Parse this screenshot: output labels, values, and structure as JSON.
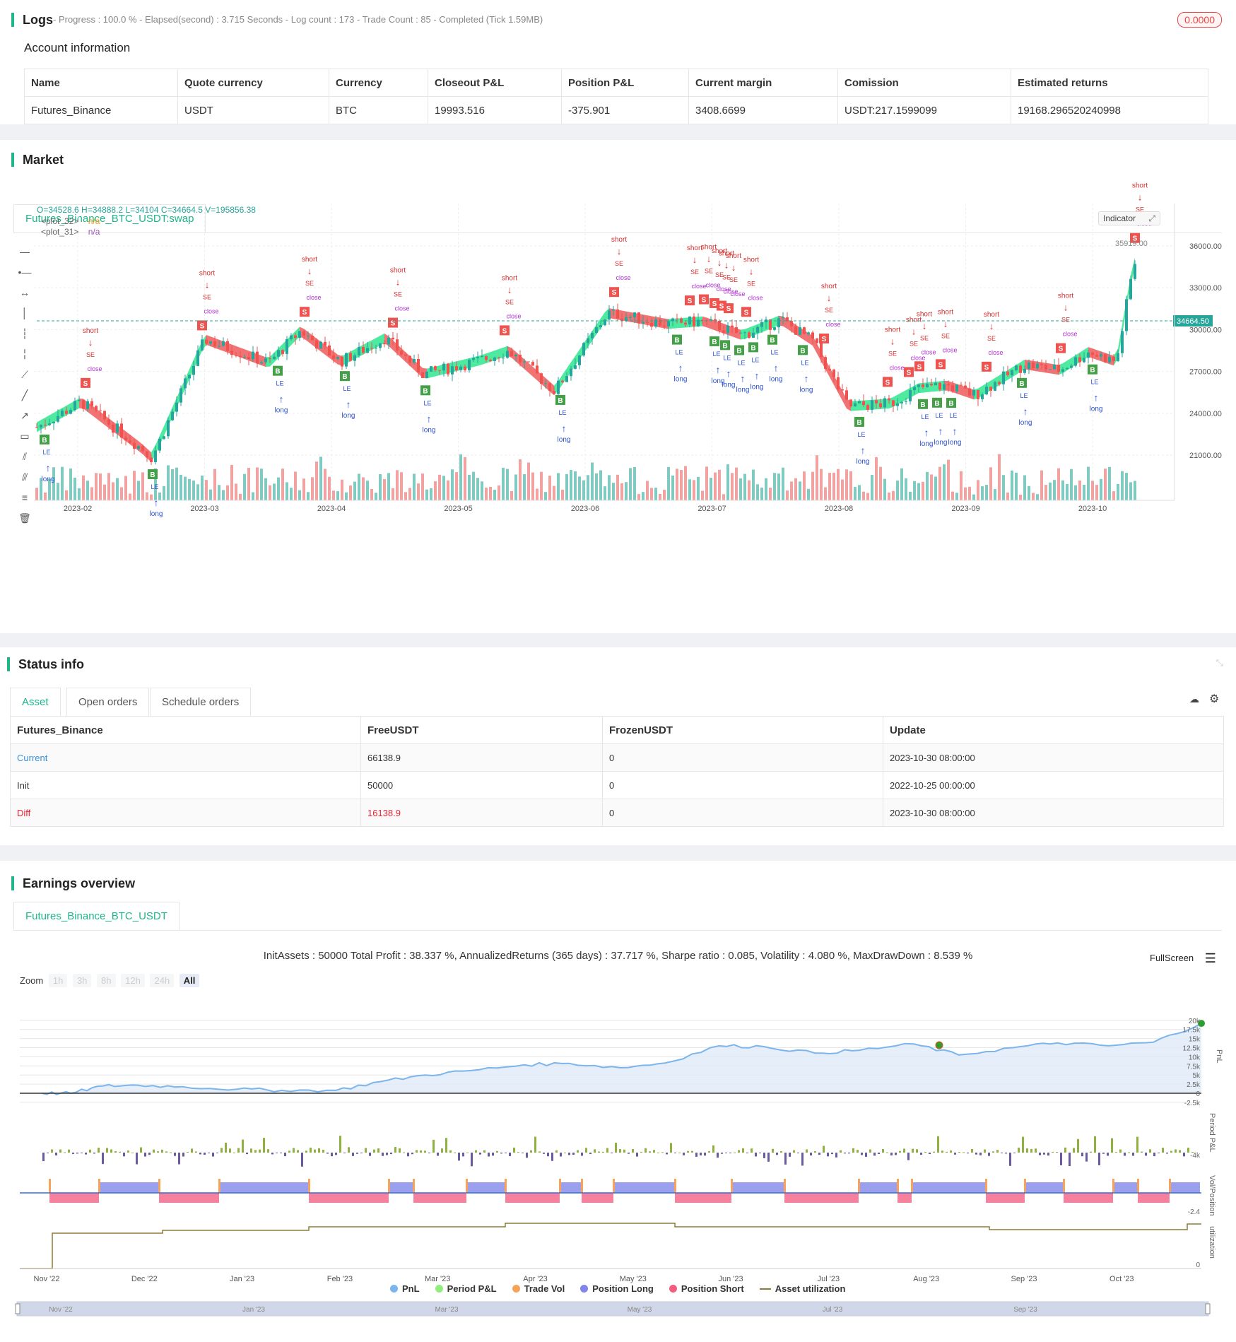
{
  "logs": {
    "title": "Logs",
    "meta": "- Progress : 100.0 % - Elapsed(second) : 3.715  Seconds - Log count : 173 - Trade Count : 85 - Completed (Tick 1.59MB)",
    "badge": "0.0000"
  },
  "account": {
    "title": "Account information",
    "headers": [
      "Name",
      "Quote currency",
      "Currency",
      "Closeout P&L",
      "Position P&L",
      "Current margin",
      "Comission",
      "Estimated returns"
    ],
    "row": [
      "Futures_Binance",
      "USDT",
      "BTC",
      "19993.516",
      "-375.901",
      "3408.6699",
      "USDT:217.1599099",
      "19168.296520240998"
    ]
  },
  "market": {
    "title": "Market",
    "tab": "Futures_Binance_BTC_USDT:swap",
    "ohlc": "O=34528.6 H=34888.2 L=34104 C=34664.5 V=195856.38",
    "plot32": "<plot_32>",
    "plot31": "<plot_31>",
    "na": "n/a",
    "indicator_btn": "Indicator",
    "price_label": "34664.50",
    "high_label": "35919.00",
    "y_ticks": [
      "36000.00",
      "33000.00",
      "30000.00",
      "27000.00",
      "24000.00",
      "21000.00"
    ],
    "x_ticks": [
      "2023-02",
      "2023-03",
      "2023-04",
      "2023-05",
      "2023-06",
      "2023-07",
      "2023-08",
      "2023-09",
      "2023-10"
    ],
    "signal_words": {
      "short": "short",
      "long": "long",
      "close": "close",
      "se": "SE",
      "le": "LE",
      "one": "1",
      "s": "S",
      "b": "B"
    }
  },
  "status": {
    "title": "Status info",
    "tabs": [
      "Asset",
      "Open orders",
      "Schedule orders"
    ],
    "headers": [
      "Futures_Binance",
      "FreeUSDT",
      "FrozenUSDT",
      "Update"
    ],
    "rows": [
      [
        "Current",
        "66138.9",
        "0",
        "2023-10-30 08:00:00"
      ],
      [
        "Init",
        "50000",
        "0",
        "2022-10-25 00:00:00"
      ],
      [
        "Diff",
        "16138.9",
        "0",
        "2023-10-30 08:00:00"
      ]
    ]
  },
  "earnings": {
    "title": "Earnings overview",
    "tab": "Futures_Binance_BTC_USDT",
    "summary": "InitAssets : 50000 Total Profit : 38.337 %, AnnualizedReturns (365 days) : 37.717 %, Sharpe ratio : 0.085, Volatility : 4.080 %, MaxDrawDown : 8.539 %",
    "fullscreen": "FullScreen",
    "zoom_label": "Zoom",
    "zoom_buttons": [
      "1h",
      "3h",
      "8h",
      "12h",
      "24h",
      "All"
    ],
    "pnl_ticks": [
      "20k",
      "17.5k",
      "15k",
      "12.5k",
      "10k",
      "7.5k",
      "5k",
      "2.5k",
      "0",
      "-2.5k"
    ],
    "period_tick": "-4k",
    "vol_tick": "-2.4",
    "util_tick": "0",
    "axis_pnl": "PnL",
    "axis_period": "Period P&L",
    "axis_vol": "Vol/Position",
    "axis_util": "utilization",
    "x_ticks": [
      "Nov '22",
      "Dec '22",
      "Jan '23",
      "Feb '23",
      "Mar '23",
      "Apr '23",
      "May '23",
      "Jun '23",
      "Jul '23",
      "Aug '23",
      "Sep '23",
      "Oct '23"
    ],
    "nav_ticks": [
      "Nov '22",
      "Jan '23",
      "Mar '23",
      "May '23",
      "Jul '23",
      "Sep '23"
    ],
    "legend": [
      {
        "label": "PnL",
        "color": "#7cb5ec"
      },
      {
        "label": "Period P&L",
        "color": "#90ed7d"
      },
      {
        "label": "Trade Vol",
        "color": "#f7a35c"
      },
      {
        "label": "Position Long",
        "color": "#8085e9"
      },
      {
        "label": "Position Short",
        "color": "#f15c80"
      },
      {
        "label": "Asset utilization",
        "color": "#8d7a3a"
      }
    ]
  },
  "chart_data": {
    "type": "line",
    "series": [
      {
        "name": "PnL",
        "x": [
          "2022-11-01",
          "2022-11-10",
          "2022-11-20",
          "2022-12-01",
          "2022-12-15",
          "2023-01-01",
          "2023-01-15",
          "2023-02-01",
          "2023-02-15",
          "2023-03-01",
          "2023-03-15",
          "2023-04-01",
          "2023-04-15",
          "2023-05-01",
          "2023-05-15",
          "2023-06-01",
          "2023-06-15",
          "2023-07-01",
          "2023-07-15",
          "2023-08-01",
          "2023-08-15",
          "2023-09-01",
          "2023-09-15",
          "2023-10-01",
          "2023-10-15",
          "2023-10-30"
        ],
        "y": [
          0,
          0,
          2000,
          2200,
          1800,
          1100,
          800,
          800,
          3200,
          5000,
          6200,
          7800,
          8200,
          7000,
          8300,
          13000,
          12800,
          11000,
          11800,
          13500,
          10500,
          12500,
          13800,
          13000,
          14000,
          19168
        ]
      }
    ]
  }
}
